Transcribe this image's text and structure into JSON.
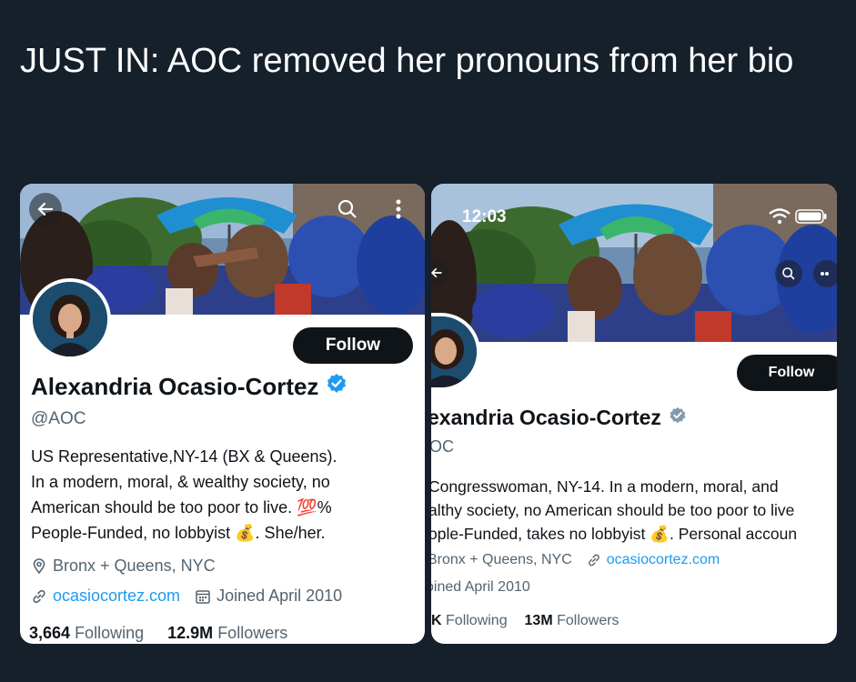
{
  "headline": "JUST IN: AOC removed her pronouns from her bio",
  "left_card": {
    "follow_label": "Follow",
    "name": "Alexandria Ocasio-Cortez",
    "handle": "@AOC",
    "bio_lines": [
      "US Representative,NY-14 (BX & Queens).",
      "In a modern, moral, & wealthy society, no",
      "American should be too poor to live. 💯%",
      "People-Funded, no lobbyist 💰. She/her."
    ],
    "location": "Bronx + Queens, NYC",
    "website": "ocasiocortez.com",
    "joined": "Joined April 2010",
    "following_count": "3,664",
    "following_label": "Following",
    "followers_count": "12.9M",
    "followers_label": "Followers"
  },
  "right_card": {
    "status_time": "12:03",
    "follow_label": "Follow",
    "name": "exandria Ocasio-Cortez",
    "handle": "OC",
    "bio_lines": [
      "Congresswoman, NY-14. In a modern, moral, and",
      "althy society, no American should be too poor to live",
      "ople-Funded, takes no lobbyist 💰. Personal accoun"
    ],
    "location": "Bronx + Queens, NYC",
    "website": "ocasiocortez.com",
    "joined": "oined April 2010",
    "following_count": "K",
    "following_label": "Following",
    "followers_count": "13M",
    "followers_label": "Followers"
  },
  "colors": {
    "background": "#15202b",
    "verified_blue": "#1d9bf0",
    "verified_gray": "#829aab",
    "link": "#1d9bf0",
    "follow_button": "#0f1419"
  },
  "icons": [
    "back-arrow-icon",
    "search-icon",
    "more-vertical-icon",
    "verified-badge-icon",
    "location-pin-icon",
    "link-icon",
    "calendar-icon",
    "wifi-icon",
    "battery-icon",
    "more-horizontal-icon"
  ]
}
